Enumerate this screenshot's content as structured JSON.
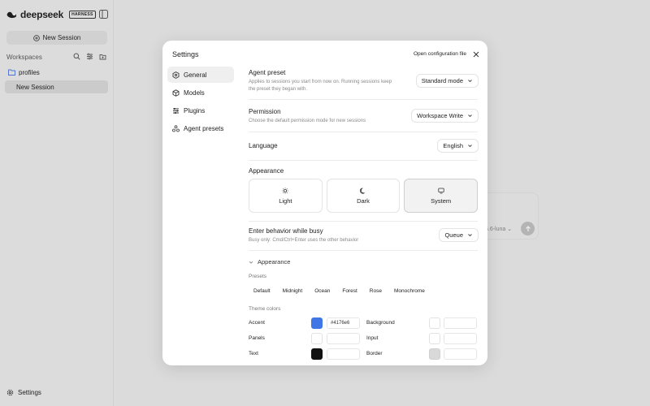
{
  "sidebar": {
    "brand": "deepseek",
    "badge": "HARNESS",
    "new_session": "New Session",
    "workspaces_label": "Workspaces",
    "items": [
      {
        "label": "profiles",
        "icon": "folder-icon"
      },
      {
        "label": "New Session"
      }
    ],
    "settings": "Settings"
  },
  "composer": {
    "model": "5.6-luna"
  },
  "modal": {
    "title": "Settings",
    "open_config": "Open configuration file",
    "nav": [
      {
        "label": "General",
        "icon": "hexagon-icon",
        "active": true
      },
      {
        "label": "Models",
        "icon": "cube-icon"
      },
      {
        "label": "Plugins",
        "icon": "sliders-icon"
      },
      {
        "label": "Agent presets",
        "icon": "users-icon"
      }
    ],
    "agent_preset": {
      "title": "Agent preset",
      "desc": "Applies to sessions you start from now on. Running sessions keep the preset they began with.",
      "value": "Standard mode"
    },
    "permission": {
      "title": "Permission",
      "desc": "Choose the default permission mode for new sessions",
      "value": "Workspace Write"
    },
    "language": {
      "title": "Language",
      "value": "English"
    },
    "appearance": {
      "title": "Appearance",
      "options": [
        {
          "label": "Light",
          "icon": "sun-icon"
        },
        {
          "label": "Dark",
          "icon": "moon-icon"
        },
        {
          "label": "System",
          "icon": "monitor-icon",
          "selected": true
        }
      ]
    },
    "enter_behavior": {
      "title": "Enter behavior while busy",
      "desc": "Busy only: Cmd/Ctrl+Enter uses the other behavior",
      "value": "Queue"
    },
    "appearance_section": {
      "title": "Appearance",
      "presets_label": "Presets",
      "presets": [
        "Default",
        "Midnight",
        "Ocean",
        "Forest",
        "Rose",
        "Monochrome"
      ],
      "theme_colors_label": "Theme colors",
      "colors": [
        {
          "left_label": "Accent",
          "left_color": "#4176e6",
          "left_hex": "#4176e6",
          "right_label": "Background",
          "right_color": "#ffffff",
          "right_hex": ""
        },
        {
          "left_label": "Panels",
          "left_color": "#ffffff",
          "left_hex": "",
          "right_label": "Input",
          "right_color": "#ffffff",
          "right_hex": ""
        },
        {
          "left_label": "Text",
          "left_color": "#111111",
          "left_hex": "",
          "right_label": "Border",
          "right_color": "#d9d9d9",
          "right_hex": ""
        }
      ]
    }
  }
}
